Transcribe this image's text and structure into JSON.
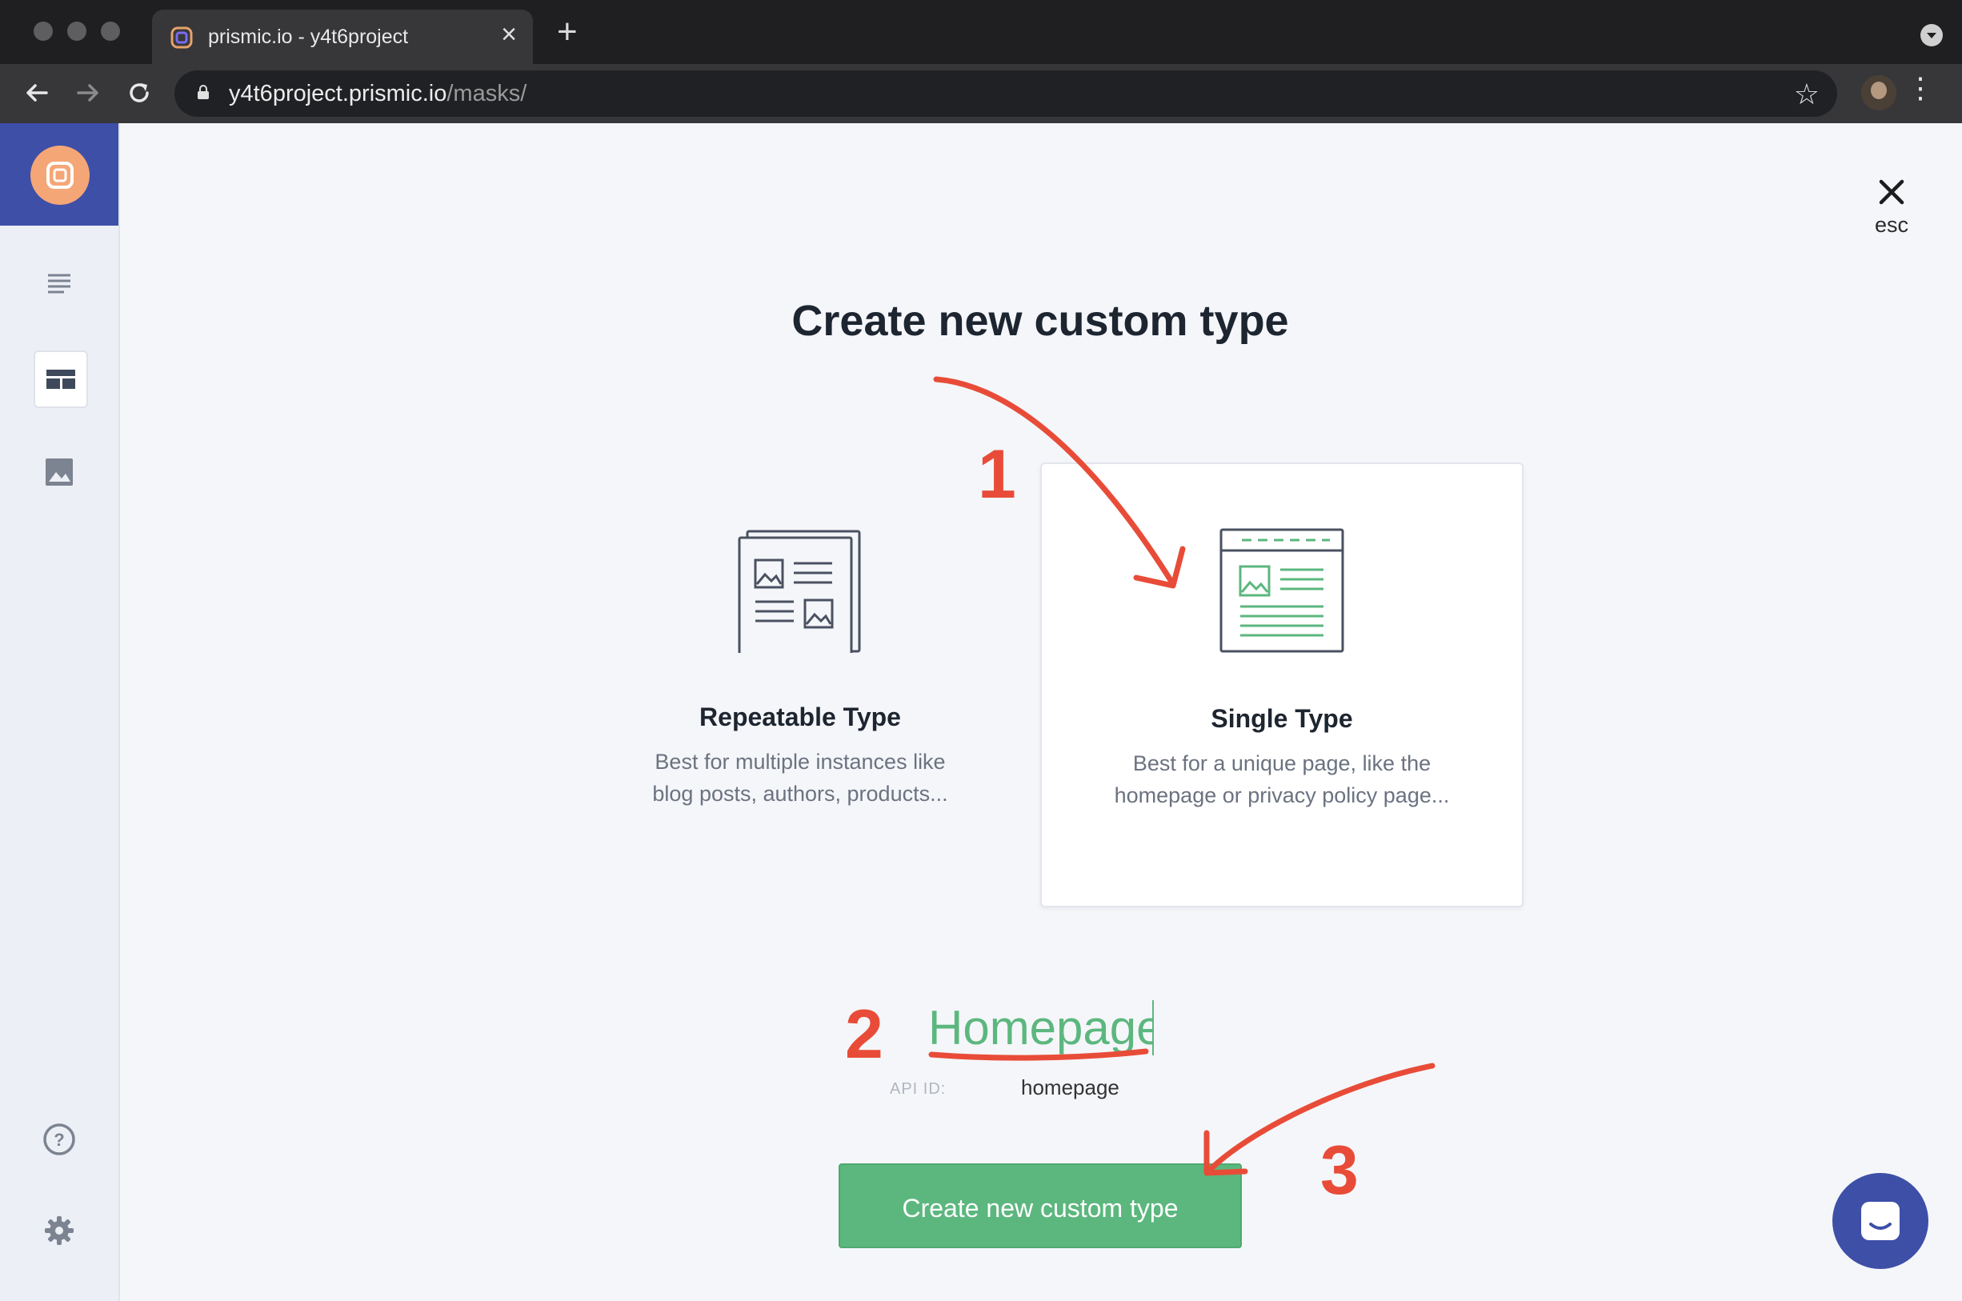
{
  "browser": {
    "tab_title": "prismic.io - y4t6project",
    "url_host": "y4t6project.prismic.io",
    "url_path": "/masks/"
  },
  "modal": {
    "esc_label": "esc",
    "heading": "Create new custom type",
    "options": [
      {
        "title": "Repeatable Type",
        "description": "Best for multiple instances like blog posts, authors, products...",
        "selected": false
      },
      {
        "title": "Single Type",
        "description": "Best for a unique page, like the homepage or privacy policy page...",
        "selected": true
      }
    ],
    "name_value": "Homepage",
    "api_id_label": "API ID:",
    "api_id_value": "homepage",
    "create_button": "Create new custom type"
  },
  "annotations": {
    "step1": "1",
    "step2": "2",
    "step3": "3",
    "color": "#e84c38"
  },
  "colors": {
    "accent_green": "#5cb77e",
    "brand_blue": "#3e4fa8",
    "logo_orange": "#f5a676"
  }
}
